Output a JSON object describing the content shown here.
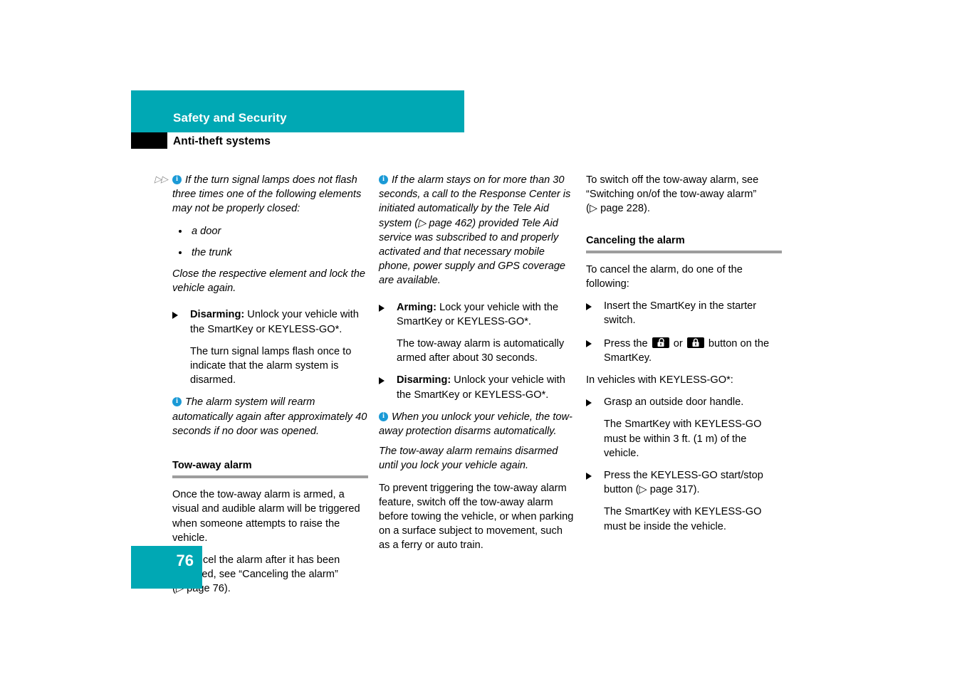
{
  "header": {
    "section_title": "Safety and Security",
    "subsection_title": "Anti-theft systems"
  },
  "page_number": "76",
  "columns": {
    "column_1": {
      "continuation_marker": "▷▷",
      "note_1": "If the turn signal lamps does not flash three times one of the following elements may not be properly closed:",
      "bullets": [
        "a door",
        "the trunk"
      ],
      "note_1_close": "Close the respective element and lock the vehicle again.",
      "item_disarming_lead": "Disarming:",
      "item_disarming_text": " Unlock your vehicle with the SmartKey or KEYLESS-GO*.",
      "item_disarming_sub": "The turn signal lamps flash once to indicate that the alarm system is disarmed.",
      "note_2": "The alarm system will rearm automatically again after approximately 40 seconds if no door was opened.",
      "subhead_tow_away": "Tow-away alarm",
      "para_1": "Once the tow-away alarm is armed, a visual and audible alarm will be triggered when someone attempts to raise the vehicle.",
      "para_2": "To cancel the alarm after it has been triggered, see “Canceling the alarm”",
      "para_2_ref": "(▷ page 76)."
    },
    "column_2": {
      "note_1": "If the alarm stays on for more than 30 seconds, a call to the Response Center is initiated automatically by the Tele Aid system (▷ page 462) provided Tele Aid service was subscribed to and properly activated and that necessary mobile phone, power supply and GPS coverage are available.",
      "item_arming_lead": "Arming:",
      "item_arming_text": " Lock your vehicle with the SmartKey or KEYLESS-GO*.",
      "item_arming_sub": "The tow-away alarm is automatically armed after about 30 seconds.",
      "item_disarming_lead": "Disarming:",
      "item_disarming_text": " Unlock your vehicle with the SmartKey or KEYLESS-GO*.",
      "note_2": "When you unlock your vehicle, the tow-away protection disarms automatically.",
      "note_2_cont": "The tow-away alarm remains disarmed until you lock your vehicle again.",
      "para_1": "To prevent triggering the tow-away alarm feature, switch off the tow-away alarm before towing the vehicle, or when parking on a surface subject to movement, such as a ferry or auto train."
    },
    "column_3": {
      "para_1": "To switch off the tow-away alarm, see “Switching on/of the tow-away alarm”",
      "para_1_ref": "(▷ page 228).",
      "subhead_canceling": "Canceling the alarm",
      "para_2": "To cancel the alarm, do one of the following:",
      "item_insert": "Insert the SmartKey in the starter switch.",
      "item_press_prefix": "Press the ",
      "item_press_or": " or ",
      "item_press_suffix": " button on the SmartKey.",
      "unlock_button_icon": "unlock-padlock-icon",
      "lock_button_icon": "lock-padlock-icon",
      "para_3": "In vehicles with KEYLESS-GO*:",
      "item_grasp": "Grasp an outside door handle.",
      "item_grasp_sub": "The SmartKey with KEYLESS-GO must be within 3 ft. (1 m) of the vehicle.",
      "item_press_start": "Press the KEYLESS-GO start/stop button (▷ page 317).",
      "item_press_start_sub": "The SmartKey with KEYLESS-GO must be inside the vehicle."
    }
  },
  "colors": {
    "accent_teal": "#00a8b4",
    "info_blue": "#1b9ad6",
    "rule_gray": "#9d9d9d"
  }
}
